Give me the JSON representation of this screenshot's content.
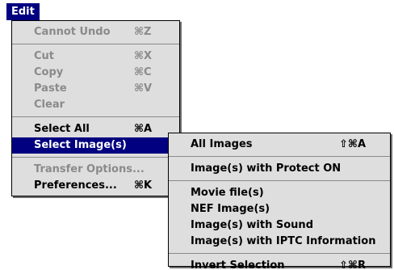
{
  "menu_bar": {
    "title": "Edit"
  },
  "edit_menu": {
    "items": [
      {
        "label": "Cannot Undo",
        "shortcut": "⌘Z",
        "enabled": false
      },
      {
        "label": "Cut",
        "shortcut": "⌘X",
        "enabled": false
      },
      {
        "label": "Copy",
        "shortcut": "⌘C",
        "enabled": false
      },
      {
        "label": "Paste",
        "shortcut": "⌘V",
        "enabled": false
      },
      {
        "label": "Clear",
        "shortcut": "",
        "enabled": false
      },
      {
        "label": "Select All",
        "shortcut": "⌘A",
        "enabled": true
      },
      {
        "label": "Select Image(s)",
        "shortcut": "",
        "enabled": true,
        "highlighted": true,
        "has_submenu": true
      },
      {
        "label": "Transfer Options...",
        "shortcut": "",
        "enabled": false
      },
      {
        "label": "Preferences...",
        "shortcut": "⌘K",
        "enabled": true
      }
    ]
  },
  "select_images_submenu": {
    "items": [
      {
        "label": "All Images",
        "shortcut": "⇧⌘A"
      },
      {
        "label": "Image(s) with Protect ON",
        "shortcut": ""
      },
      {
        "label": "Movie file(s)",
        "shortcut": ""
      },
      {
        "label": "NEF Image(s)",
        "shortcut": ""
      },
      {
        "label": "Image(s) with Sound",
        "shortcut": ""
      },
      {
        "label": "Image(s) with IPTC Information",
        "shortcut": ""
      },
      {
        "label": "Invert Selection",
        "shortcut": "⇧⌘R"
      }
    ]
  },
  "colors": {
    "highlight": "#000080",
    "menu_bg": "#dedede",
    "disabled_text": "#8a8a8a"
  }
}
